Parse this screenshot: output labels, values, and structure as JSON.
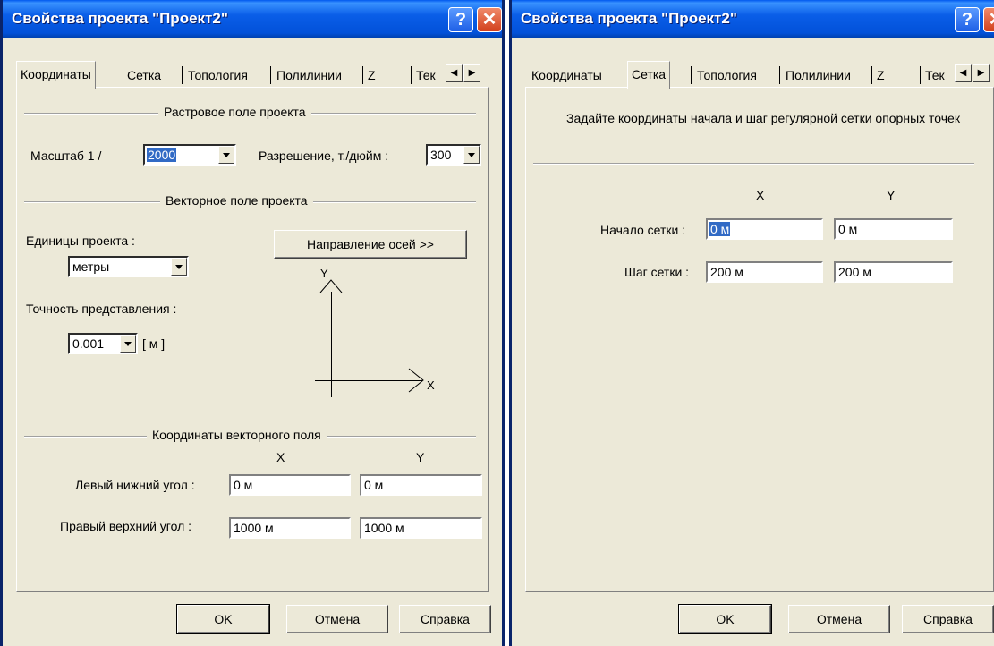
{
  "dialog_left": {
    "title": "Свойства проекта \"Проект2\"",
    "help_label": "?",
    "close_label": "✕",
    "tabs": [
      "Координаты",
      "Сетка",
      "Топология",
      "Полилинии",
      "Z",
      "Тек"
    ],
    "active_tab": "Координаты",
    "raster_group": "Растровое поле проекта",
    "scale_label": "Масштаб 1 /",
    "scale_value": "2000",
    "resolution_label": "Разрешение, т./дюйм :",
    "resolution_value": "300",
    "vector_group": "Векторное поле проекта",
    "units_label": "Единицы проекта :",
    "units_value": "метры",
    "axes_button": "Направление осей >>",
    "precision_label": "Точность представления :",
    "precision_value": "0.001",
    "precision_unit": "[ м ]",
    "axis_y": "Y",
    "axis_x": "X",
    "coords_group": "Координаты векторного поля",
    "col_x": "X",
    "col_y": "Y",
    "lower_left_label": "Левый нижний угол :",
    "lower_left_x": "0 м",
    "lower_left_y": "0 м",
    "upper_right_label": "Правый верхний угол :",
    "upper_right_x": "1000 м",
    "upper_right_y": "1000 м",
    "ok": "OK",
    "cancel": "Отмена",
    "help": "Справка"
  },
  "dialog_right": {
    "title": "Свойства проекта \"Проект2\"",
    "help_label": "?",
    "close_label": "✕",
    "tabs": [
      "Координаты",
      "Сетка",
      "Топология",
      "Полилинии",
      "Z",
      "Тек"
    ],
    "active_tab": "Сетка",
    "instructions": "Задайте координаты начала и шаг регулярной сетки опорных точек",
    "col_x": "X",
    "col_y": "Y",
    "grid_origin_label": "Начало сетки :",
    "grid_origin_x": "0 м",
    "grid_origin_y": "0 м",
    "grid_step_label": "Шаг сетки :",
    "grid_step_x": "200 м",
    "grid_step_y": "200 м",
    "ok": "OK",
    "cancel": "Отмена",
    "help": "Справка"
  },
  "colors": {
    "titlebar": "#0a5ee8",
    "dialog_bg": "#ece9d8",
    "selection": "#316ac5"
  }
}
